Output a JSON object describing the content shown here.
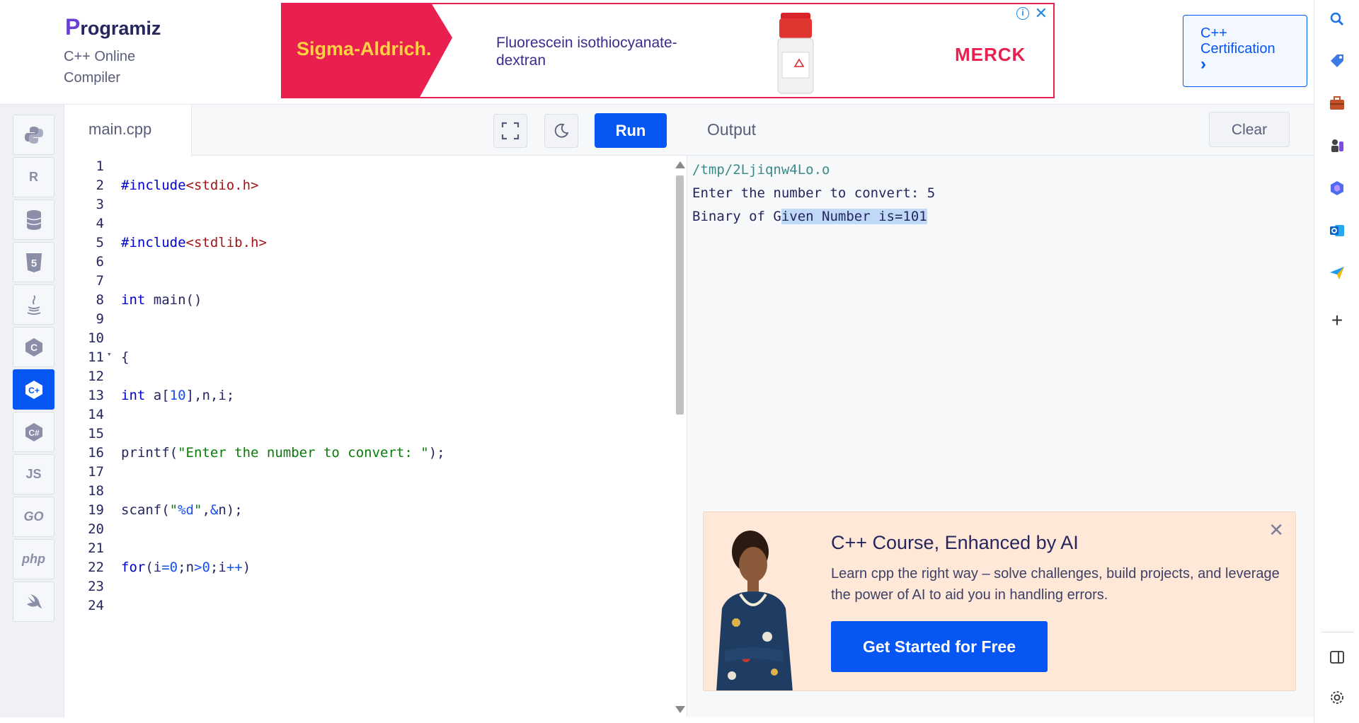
{
  "header": {
    "logo_text": "rogramiz",
    "logo_letter": "P",
    "subtitle": "C++ Online Compiler",
    "certification_button": "C++ Certification",
    "certification_chevron": "›"
  },
  "ad": {
    "brand": "Sigma-Aldrich.",
    "product_text": "Fluorescein isothiocyanate-dextran",
    "partner": "MERCK",
    "info_icon": "i",
    "close_icon": "✕",
    "colors": {
      "accent": "#e9204f",
      "brand_text": "#ffd23f"
    }
  },
  "language_sidebar": {
    "items": [
      {
        "name": "python",
        "label": "Py"
      },
      {
        "name": "r",
        "label": "R"
      },
      {
        "name": "sql",
        "label": "DB"
      },
      {
        "name": "html",
        "label": "5"
      },
      {
        "name": "java",
        "label": "J"
      },
      {
        "name": "c",
        "label": "C"
      },
      {
        "name": "cpp",
        "label": "C+"
      },
      {
        "name": "csharp",
        "label": "C#"
      },
      {
        "name": "js",
        "label": "JS"
      },
      {
        "name": "go",
        "label": "GO"
      },
      {
        "name": "php",
        "label": "php"
      },
      {
        "name": "swift",
        "label": "S"
      }
    ],
    "active": "cpp"
  },
  "editor": {
    "file_name": "main.cpp",
    "run_label": "Run",
    "lines": [
      {
        "n": "1",
        "code": ""
      },
      {
        "n": "2",
        "code": "#include<stdio.h>"
      },
      {
        "n": "3",
        "code": ""
      },
      {
        "n": "4",
        "code": ""
      },
      {
        "n": "5",
        "code": "#include<stdlib.h>"
      },
      {
        "n": "6",
        "code": ""
      },
      {
        "n": "7",
        "code": ""
      },
      {
        "n": "8",
        "code": "int main()"
      },
      {
        "n": "9",
        "code": ""
      },
      {
        "n": "10",
        "code": ""
      },
      {
        "n": "11",
        "code": "{"
      },
      {
        "n": "12",
        "code": ""
      },
      {
        "n": "13",
        "code": "int a[10],n,i;"
      },
      {
        "n": "14",
        "code": ""
      },
      {
        "n": "15",
        "code": ""
      },
      {
        "n": "16",
        "code": "printf(\"Enter the number to convert: \");"
      },
      {
        "n": "17",
        "code": ""
      },
      {
        "n": "18",
        "code": ""
      },
      {
        "n": "19",
        "code": "scanf(\"%d\",&n);"
      },
      {
        "n": "20",
        "code": ""
      },
      {
        "n": "21",
        "code": ""
      },
      {
        "n": "22",
        "code": "for(i=0;n>0;i++)"
      },
      {
        "n": "23",
        "code": ""
      },
      {
        "n": "24",
        "code": ""
      }
    ]
  },
  "output": {
    "title": "Output",
    "clear_label": "Clear",
    "path_line": "/tmp/2Ljiqnw4Lo.o",
    "line1": "Enter the number to convert: 5",
    "line2_prefix": "Binary of G",
    "line2_selected": "iven Number is=101"
  },
  "promo": {
    "title": "C++ Course, Enhanced by AI",
    "description": "Learn cpp the right way – solve challenges, build projects, and leverage the power of AI to aid you in handling errors.",
    "cta": "Get Started for Free",
    "close_icon": "✕"
  },
  "browser_sidebar": {
    "icons": [
      "search-icon",
      "tag-icon",
      "briefcase-icon",
      "games-icon",
      "copilot-icon",
      "outlook-icon",
      "send-icon",
      "add-icon",
      "split-view-icon",
      "settings-icon"
    ]
  }
}
